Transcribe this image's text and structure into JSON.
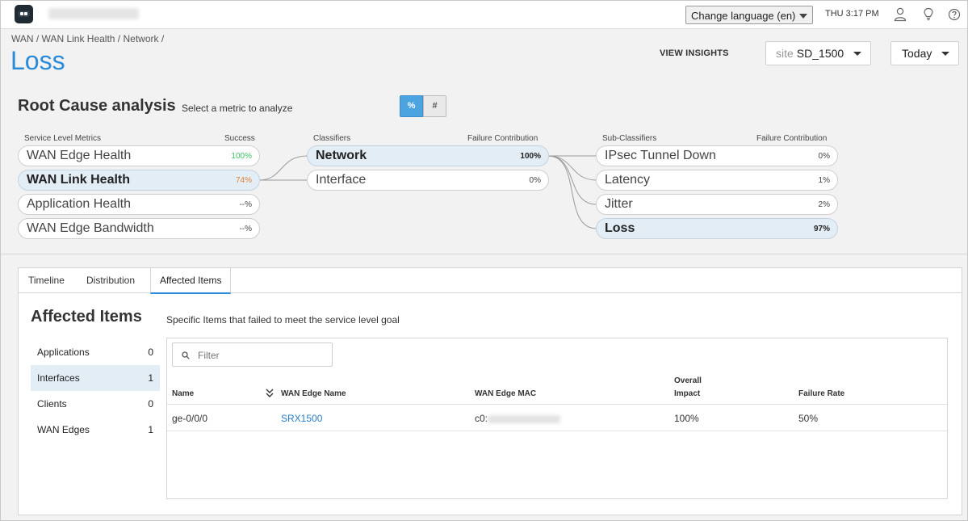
{
  "topbar": {
    "language": "Change language (en)",
    "clock": "THU 3:17 PM",
    "icons": [
      "user-icon",
      "lightbulb-icon",
      "help-icon"
    ]
  },
  "header": {
    "breadcrumb": "WAN / WAN Link Health / Network /",
    "title": "Loss",
    "view_insights": "VIEW INSIGHTS",
    "site_prefix": "site",
    "site_value": "SD_1500",
    "period": "Today"
  },
  "rca": {
    "title": "Root Cause analysis",
    "subtitle": "Select a metric to analyze",
    "toggle_percent": "%",
    "toggle_count": "#",
    "columns": {
      "slm": "Service Level Metrics",
      "success": "Success",
      "classifiers": "Classifiers",
      "fc1": "Failure Contribution",
      "subclassifiers": "Sub-Classifiers",
      "fc2": "Failure Contribution"
    },
    "metrics": [
      {
        "label": "WAN Edge Health",
        "value": "100%",
        "color": "#3bbf64"
      },
      {
        "label": "WAN Link Health",
        "value": "74%",
        "color": "#e08234"
      },
      {
        "label": "Application Health",
        "value": "--%"
      },
      {
        "label": "WAN Edge Bandwidth",
        "value": "--%"
      }
    ],
    "classifiers": [
      {
        "label": "Network",
        "value": "100%"
      },
      {
        "label": "Interface",
        "value": "0%"
      }
    ],
    "subclassifiers": [
      {
        "label": "IPsec Tunnel Down",
        "value": "0%"
      },
      {
        "label": "Latency",
        "value": "1%"
      },
      {
        "label": "Jitter",
        "value": "2%"
      },
      {
        "label": "Loss",
        "value": "97%"
      }
    ]
  },
  "tabs": [
    "Timeline",
    "Distribution",
    "Affected Items"
  ],
  "affected": {
    "title": "Affected Items",
    "subtitle": "Specific Items that failed to meet the service level goal",
    "categories": [
      {
        "name": "Applications",
        "count": "0"
      },
      {
        "name": "Interfaces",
        "count": "1"
      },
      {
        "name": "Clients",
        "count": "0"
      },
      {
        "name": "WAN Edges",
        "count": "1"
      }
    ],
    "filter_placeholder": "Filter",
    "columns": {
      "name": "Name",
      "edge_name": "WAN Edge Name",
      "edge_mac": "WAN Edge MAC",
      "impact_line1": "Overall",
      "impact_line2": "Impact",
      "failure_rate": "Failure Rate"
    },
    "rows": [
      {
        "name": "ge-0/0/0",
        "edge_name": "SRX1500",
        "mac_prefix": "c0:",
        "impact": "100%",
        "failure_rate": "50%"
      }
    ]
  }
}
